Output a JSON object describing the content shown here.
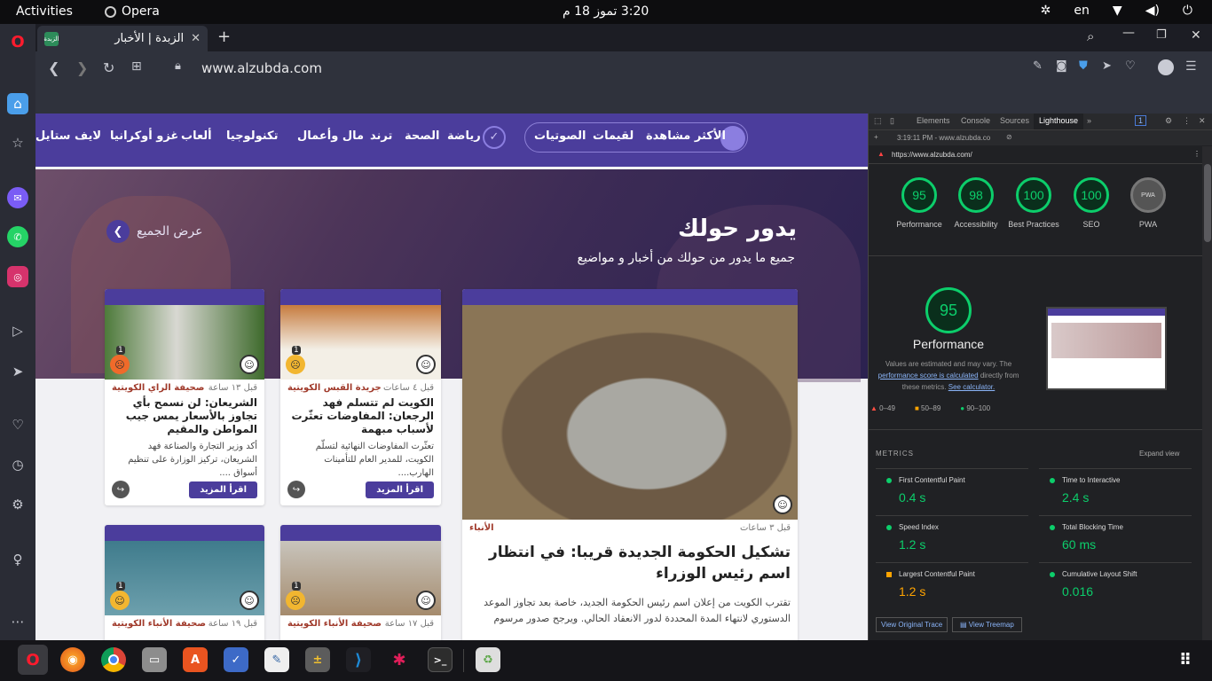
{
  "topbar": {
    "activities": "Activities",
    "app": "Opera",
    "clock": "3:20  تموز 18  م",
    "lang": "en"
  },
  "browser": {
    "tab_title": "الزبدة | الأخبار",
    "tab_favicon": "الزبدة",
    "url": "www.alzubda.com"
  },
  "site": {
    "nav": [
      "الأكثر مشاهدة",
      "لقيمات",
      "الصوتيات",
      "رياضة",
      "الصحة",
      "ترند",
      "مال وأعمال",
      "تكنولوجيا",
      "ألعاب",
      "غزو أوكرانيا",
      "لايف ستايل"
    ],
    "hero_title": "يدور حولك",
    "hero_sub": "جميع ما يدور من حولك من أخبار و مواضيع",
    "view_all": "عرض الجميع",
    "read_more": "اقرأ المزيد",
    "main": {
      "source": "الأنباء",
      "time": "قبل ٣ ساعات",
      "title": "تشكيل الحكومة الجديدة قريبا: في انتظار اسم رئيس الوزراء",
      "desc": "تقترب الكويت من إعلان اسم رئيس الحكومة الجديد، خاصة بعد تجاوز الموعد الدستوري لانتهاء المدة المحددة لدور الانعقاد الحالي. ويرجح صدور مرسوم"
    },
    "cards": [
      {
        "source": "جريدة القبس الكويتية",
        "time": "قبل ٤ ساعات",
        "title": "الكويت لم تتسلم فهد الرجعان: المفاوضات تعثّرت لأسباب مبهمة",
        "desc": "تعثّرت المفاوضات النهائية لتسلّم الكويت، للمدير العام للتأمينات الهارب....",
        "count": "1"
      },
      {
        "source": "صحيفة الراي الكويتية",
        "time": "قبل ١٣ ساعة",
        "title": "الشريعان: لن نسمح بأي تجاوز بالأسعار يمس جيب المواطن والمقيم",
        "desc": "أكد وزير التجارة والصناعة فهد الشريعان، تركيز الوزارة على تنظيم أسواق ....",
        "count": "1"
      },
      {
        "source": "صحيفة الأنباء الكويتية",
        "time": "قبل ١٧ ساعة",
        "title": "",
        "desc": "",
        "count": "1"
      },
      {
        "source": "صحيفة الأنباء الكويتية",
        "time": "قبل ١٩ ساعة",
        "title": "",
        "desc": "",
        "count": "1"
      }
    ]
  },
  "devtools": {
    "tabs": [
      "Elements",
      "Console",
      "Sources",
      "Lighthouse"
    ],
    "badge": "1",
    "session": "3:19:11 PM - www.alzubda.co",
    "audit_url": "https://www.alzubda.com/",
    "scores": [
      {
        "label": "Performance",
        "value": "95"
      },
      {
        "label": "Accessibility",
        "value": "98"
      },
      {
        "label": "Best Practices",
        "value": "100"
      },
      {
        "label": "SEO",
        "value": "100"
      },
      {
        "label": "PWA",
        "value": "PWA"
      }
    ],
    "perf_score": "95",
    "perf_title": "Performance",
    "perf_note_1": "Values are estimated and may vary. The",
    "perf_note_link": "performance score is calculated",
    "perf_note_2": "directly from these metrics.",
    "perf_note_calc": "See calculator.",
    "legend": [
      "0–49",
      "50–89",
      "90–100"
    ],
    "metrics_header": "METRICS",
    "expand": "Expand view",
    "metrics": [
      {
        "name": "First Contentful Paint",
        "value": "0.4 s",
        "color": "#0cce6b"
      },
      {
        "name": "Time to Interactive",
        "value": "2.4 s",
        "color": "#0cce6b"
      },
      {
        "name": "Speed Index",
        "value": "1.2 s",
        "color": "#0cce6b"
      },
      {
        "name": "Total Blocking Time",
        "value": "60 ms",
        "color": "#0cce6b"
      },
      {
        "name": "Largest Contentful Paint",
        "value": "1.2 s",
        "color": "#ffa400"
      },
      {
        "name": "Cumulative Layout Shift",
        "value": "0.016",
        "color": "#0cce6b"
      }
    ],
    "btn_trace": "View Original Trace",
    "btn_treemap": "View Treemap"
  }
}
